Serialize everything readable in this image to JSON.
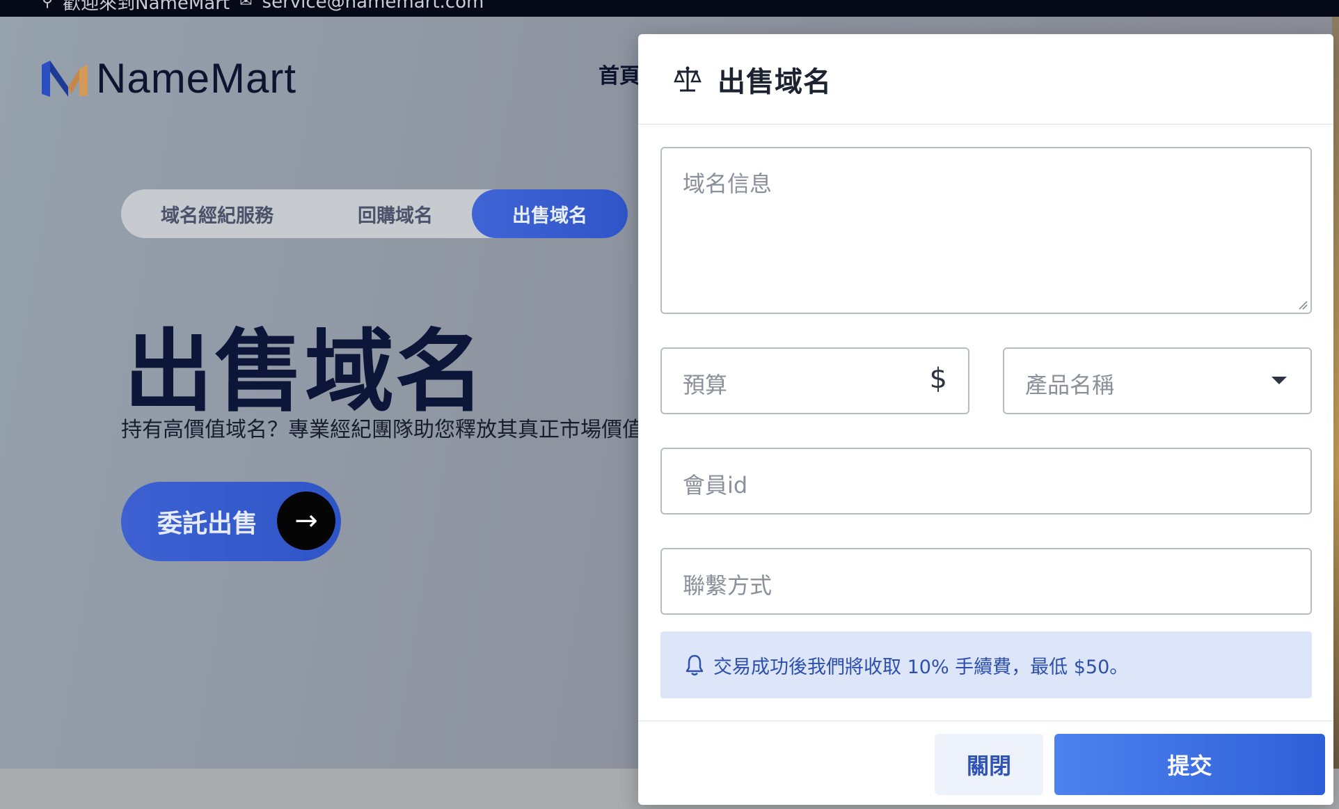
{
  "topbar": {
    "welcome": "歡迎來到NameMart",
    "email": "service@namemart.com"
  },
  "header": {
    "logo_text": "NameMart",
    "nav_first": "首頁"
  },
  "hero": {
    "tabs": [
      {
        "label": "域名經紀服務"
      },
      {
        "label": "回購域名"
      },
      {
        "label": "出售域名"
      }
    ],
    "title": "出售域名",
    "subtitle": "持有高價值域名？專業經紀團隊助您釋放其真正市場價值",
    "cta_label": "委託出售",
    "cta_arrow": "→"
  },
  "modal": {
    "title": "出售域名",
    "domain_info_placeholder": "域名信息",
    "budget_placeholder": "預算",
    "budget_symbol": "$",
    "product_placeholder": "產品名稱",
    "member_id_placeholder": "會員id",
    "contact_placeholder": "聯繫方式",
    "notice": "交易成功後我們將收取 10% 手續費，最低 $50。",
    "close_label": "關閉",
    "submit_label": "提交"
  },
  "colors": {
    "brand_blue": "#2f55c8",
    "dark_navy": "#0b1638",
    "notice_bg": "#dde6f8",
    "notice_text": "#2d4fb0"
  }
}
